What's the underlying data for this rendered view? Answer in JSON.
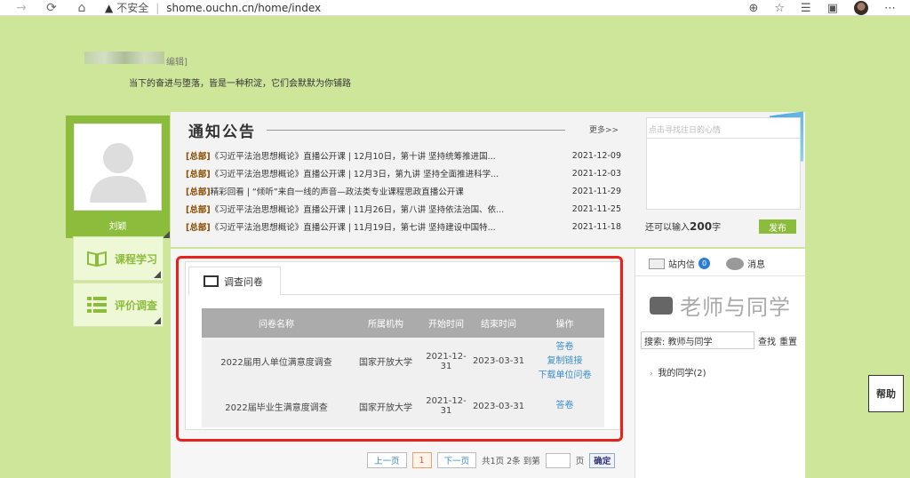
{
  "browser": {
    "security_label": "不安全",
    "url": "shome.ouchn.cn/home/index"
  },
  "header": {
    "edit_label": "编辑]",
    "motto": "当下的奋进与堕落，皆是一种积淀，它们会默默为你铺路"
  },
  "profile": {
    "name": "刘颖"
  },
  "menu": {
    "items": [
      {
        "label": "课程学习"
      },
      {
        "label": "评价调查"
      }
    ]
  },
  "notice": {
    "title": "通知公告",
    "more": "更多>>",
    "items": [
      {
        "tag": "[总部]",
        "text": "《习近平法治思想概论》直播公开课 | 12月10日，第十讲 坚持统筹推进国...",
        "date": "2021-12-09"
      },
      {
        "tag": "[总部]",
        "text": "《习近平法治思想概论》直播公开课 | 12月3日，第九讲 坚持全面推进科学...",
        "date": "2021-12-03"
      },
      {
        "tag": "[总部]",
        "text": "精彩回看 | “倾听”来自一线的声音—政法类专业课程思政直播公开课",
        "date": "2021-11-29"
      },
      {
        "tag": "[总部]",
        "text": "《习近平法治思想概论》直播公开课 | 11月26日，第八讲 坚持依法治国、依...",
        "date": "2021-11-25"
      },
      {
        "tag": "[总部]",
        "text": "《习近平法治思想概论》直播公开课 | 11月19日，第七讲 坚持建设中国特...",
        "date": "2021-11-18"
      }
    ]
  },
  "survey": {
    "tab_label": "调查问卷",
    "columns": [
      "问卷名称",
      "所属机构",
      "开始时间",
      "结束时间",
      "操作"
    ],
    "rows": [
      {
        "name": "2022届用人单位满意度调查",
        "org": "国家开放大学",
        "start": "2021-12-31",
        "end": "2023-03-31",
        "ops": [
          "答卷",
          "复制链接",
          "下载单位问卷"
        ]
      },
      {
        "name": "2022届毕业生满意度调查",
        "org": "国家开放大学",
        "start": "2021-12-31",
        "end": "2023-03-31",
        "ops": [
          "答卷"
        ]
      }
    ]
  },
  "pager": {
    "prev": "上一页",
    "current": "1",
    "next": "下一页",
    "info": "共1页 2条 到第",
    "page_suffix": "页",
    "confirm": "确定"
  },
  "note": {
    "placeholder": "点击寻找往日的心情",
    "remain_prefix": "还可以输入",
    "remain_count": "200",
    "remain_suffix": "字",
    "publish": "发布"
  },
  "social": {
    "inbox": "站内信",
    "inbox_count": "0",
    "messages": "消息",
    "title": "老师与同学",
    "search_value": "搜索: 教师与同学",
    "search_btn": "查找",
    "reset_btn": "重置",
    "classmates": "我的同学(2)"
  },
  "help": "帮助",
  "colors": {
    "accent": "#8cbc3c",
    "highlight": "#e8211c",
    "link": "#3a8dc8"
  }
}
